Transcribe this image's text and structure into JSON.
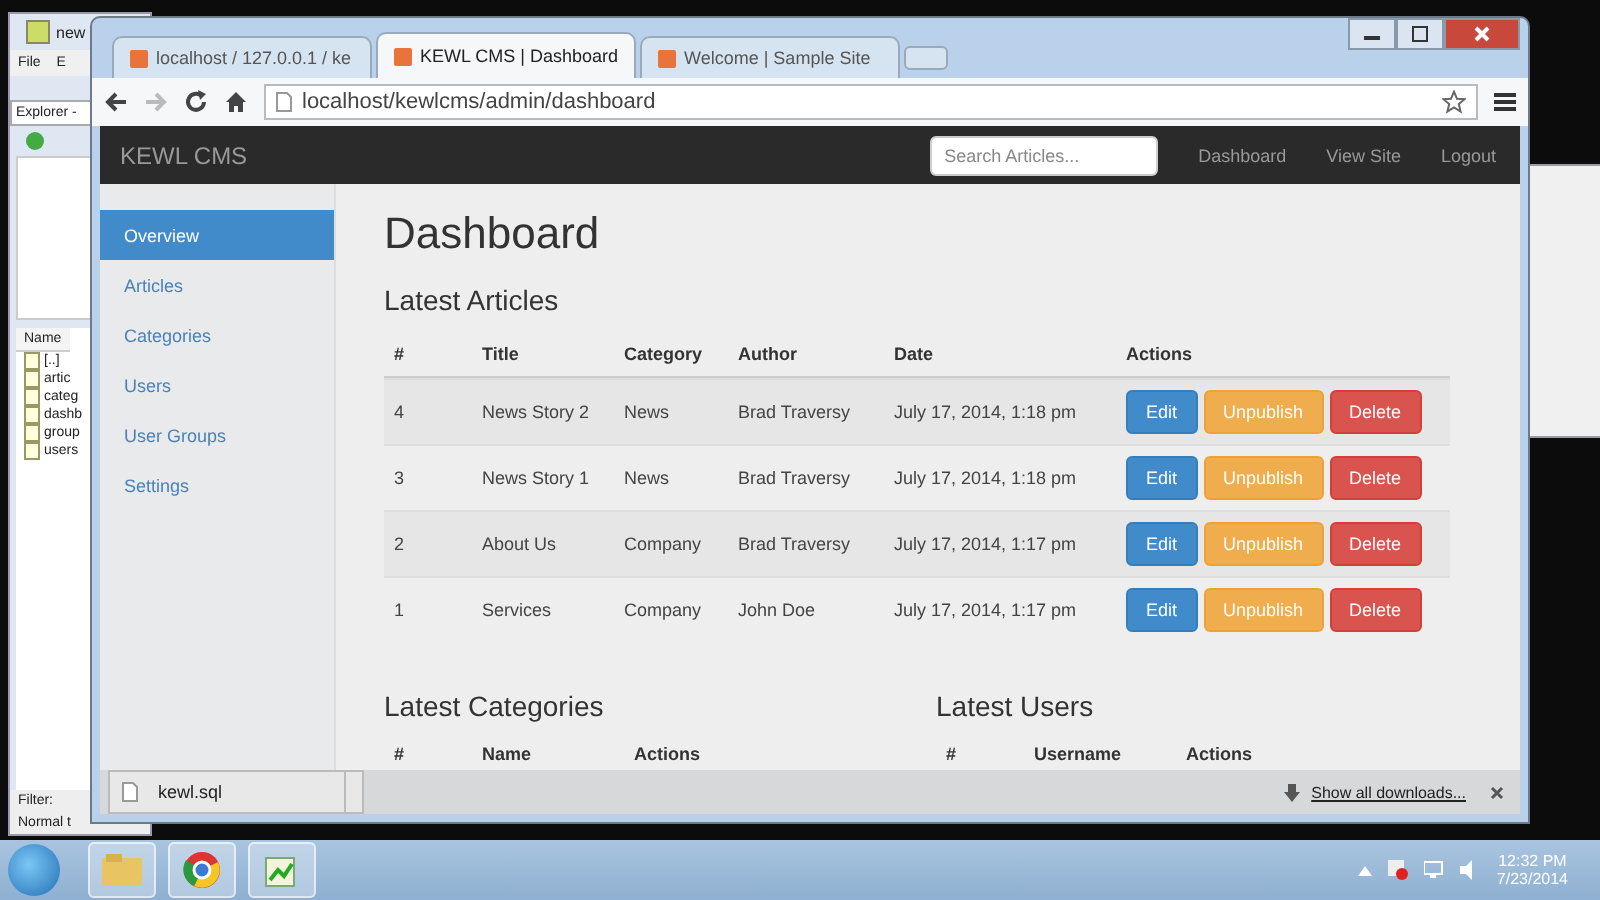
{
  "back_window": {
    "title": "new",
    "menu": [
      "File",
      "E"
    ],
    "toolbar_label": "Explorer -",
    "list_header": "Name",
    "files": [
      "[..]",
      "artic",
      "categ",
      "dashb",
      "group",
      "users"
    ],
    "filter_label": "Filter:",
    "status": "Normal t"
  },
  "browser": {
    "tabs": [
      {
        "label": "localhost / 127.0.0.1 / ke",
        "selected": false
      },
      {
        "label": "KEWL CMS | Dashboard",
        "selected": true
      },
      {
        "label": "Welcome | Sample Site",
        "selected": false
      }
    ],
    "url": "localhost/kewlcms/admin/dashboard"
  },
  "navbar": {
    "brand": "KEWL CMS",
    "search": {
      "placeholder": "Search Articles..."
    },
    "links": [
      "Dashboard",
      "View Site",
      "Logout"
    ]
  },
  "sidebar": {
    "items": [
      {
        "label": "Overview",
        "selected": true
      },
      {
        "label": "Articles",
        "selected": false
      },
      {
        "label": "Categories",
        "selected": false
      },
      {
        "label": "Users",
        "selected": false
      },
      {
        "label": "User Groups",
        "selected": false
      },
      {
        "label": "Settings",
        "selected": false
      }
    ]
  },
  "page_title": "Dashboard",
  "latest_articles": {
    "heading": "Latest Articles",
    "columns": [
      "#",
      "Title",
      "Category",
      "Author",
      "Date",
      "Actions"
    ],
    "rows": [
      {
        "cells": [
          "4",
          "News Story 2",
          "News",
          "Brad Traversy",
          "July 17, 2014, 1:18 pm"
        ],
        "actions": [
          {
            "kind": "edit",
            "label": "Edit"
          },
          {
            "kind": "unpublish",
            "label": "Unpublish"
          },
          {
            "kind": "delete",
            "label": "Delete"
          }
        ]
      },
      {
        "cells": [
          "3",
          "News Story 1",
          "News",
          "Brad Traversy",
          "July 17, 2014, 1:18 pm"
        ],
        "actions": [
          {
            "kind": "edit",
            "label": "Edit"
          },
          {
            "kind": "unpublish",
            "label": "Unpublish"
          },
          {
            "kind": "delete",
            "label": "Delete"
          }
        ]
      },
      {
        "cells": [
          "2",
          "About Us",
          "Company",
          "Brad Traversy",
          "July 17, 2014, 1:17 pm"
        ],
        "actions": [
          {
            "kind": "edit",
            "label": "Edit"
          },
          {
            "kind": "unpublish",
            "label": "Unpublish"
          },
          {
            "kind": "delete",
            "label": "Delete"
          }
        ]
      },
      {
        "cells": [
          "1",
          "Services",
          "Company",
          "John Doe",
          "July 17, 2014, 1:17 pm"
        ],
        "actions": [
          {
            "kind": "edit",
            "label": "Edit"
          },
          {
            "kind": "unpublish",
            "label": "Unpublish"
          },
          {
            "kind": "delete",
            "label": "Delete"
          }
        ]
      }
    ]
  },
  "latest_categories": {
    "heading": "Latest Categories",
    "columns": [
      "#",
      "Name",
      "Actions"
    ]
  },
  "latest_users": {
    "heading": "Latest Users",
    "columns": [
      "#",
      "Username",
      "Actions"
    ]
  },
  "downloads_bar": {
    "file": "kewl.sql",
    "show_all": "Show all downloads..."
  },
  "taskbar": {
    "time": "12:32 PM",
    "date": "7/23/2014"
  }
}
